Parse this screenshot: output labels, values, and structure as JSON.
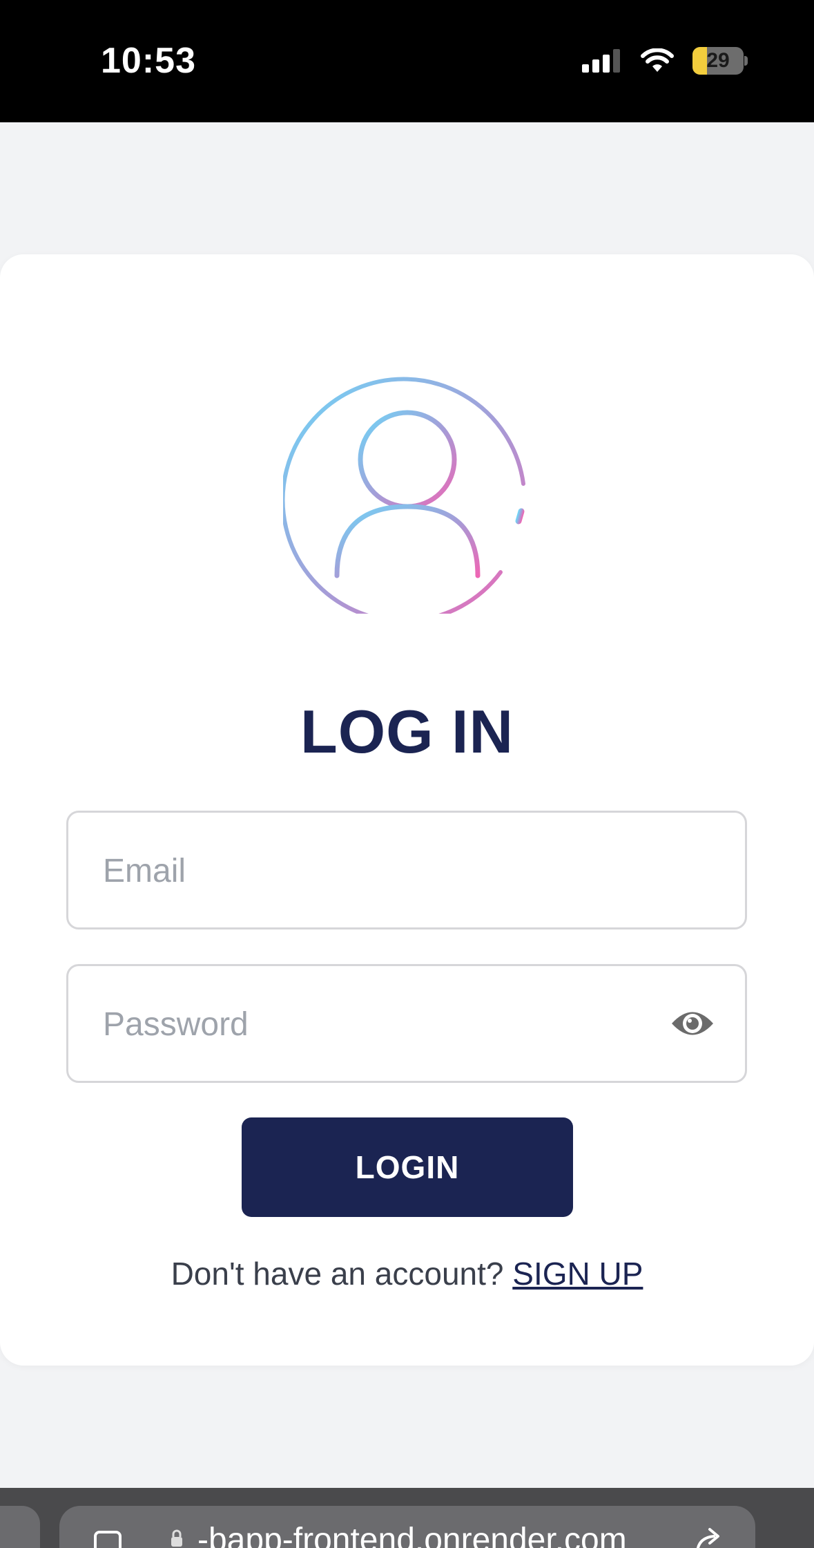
{
  "status_bar": {
    "time": "10:53",
    "battery_level": "29",
    "battery_fraction": 0.29
  },
  "login": {
    "title": "LOG IN",
    "email_placeholder": "Email",
    "password_placeholder": "Password",
    "login_button": "LOGIN",
    "signup_prompt": "Don't have an account?",
    "signup_link": "SIGN UP"
  },
  "browser": {
    "url": "-bapp-frontend.onrender.com"
  },
  "colors": {
    "primary": "#1b2452",
    "background": "#f2f3f5",
    "avatar_gradient_start": "#6fd6f7",
    "avatar_gradient_end": "#e66cbb"
  },
  "icons": [
    "signal-icon",
    "wifi-icon",
    "battery-icon",
    "avatar-icon",
    "eye-icon",
    "tabs-icon",
    "lock-icon",
    "share-icon"
  ]
}
